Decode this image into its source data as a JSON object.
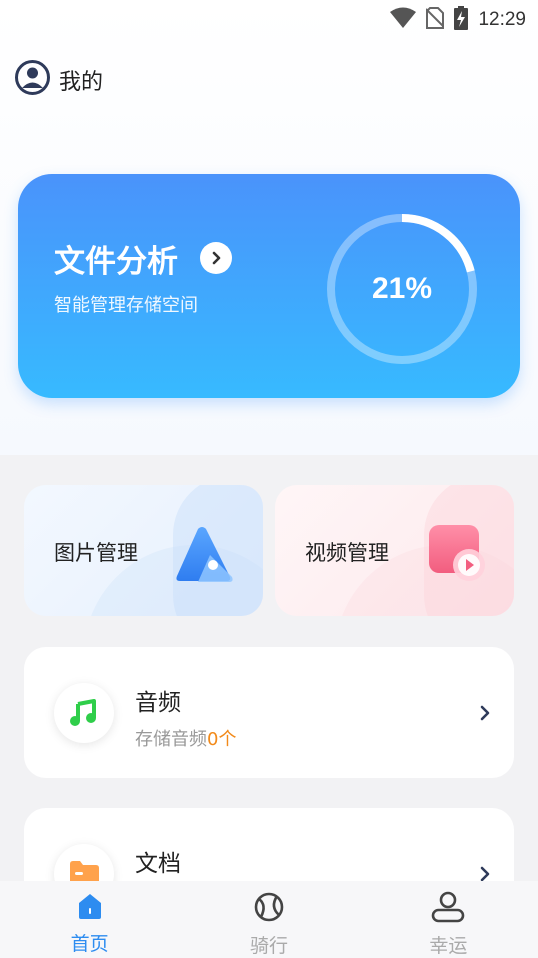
{
  "status_bar": {
    "time": "12:29",
    "icons": [
      "wifi-icon",
      "no-sim-icon",
      "battery-charging-icon"
    ]
  },
  "header": {
    "title": "我的",
    "icon": "user-circle-icon"
  },
  "analysis": {
    "title": "文件分析",
    "subtitle": "智能管理存储空间",
    "usage_percent": 21,
    "usage_label": "21%"
  },
  "tiles": [
    {
      "label": "图片管理",
      "icon": "image-icon"
    },
    {
      "label": "视频管理",
      "icon": "video-icon"
    }
  ],
  "list": [
    {
      "title": "音频",
      "sub_prefix": "存储音频",
      "count": "0个",
      "icon": "music-note-icon"
    },
    {
      "title": "文档",
      "icon": "folder-icon"
    }
  ],
  "bottom_nav": [
    {
      "label": "首页",
      "icon": "home-icon",
      "active": true
    },
    {
      "label": "骑行",
      "icon": "ball-icon",
      "active": false
    },
    {
      "label": "幸运",
      "icon": "person-icon",
      "active": false
    }
  ],
  "colors": {
    "accent": "#2d8cf0",
    "card_top": "#4a93fb",
    "card_bottom": "#37baff",
    "count": "#f28a1a"
  }
}
